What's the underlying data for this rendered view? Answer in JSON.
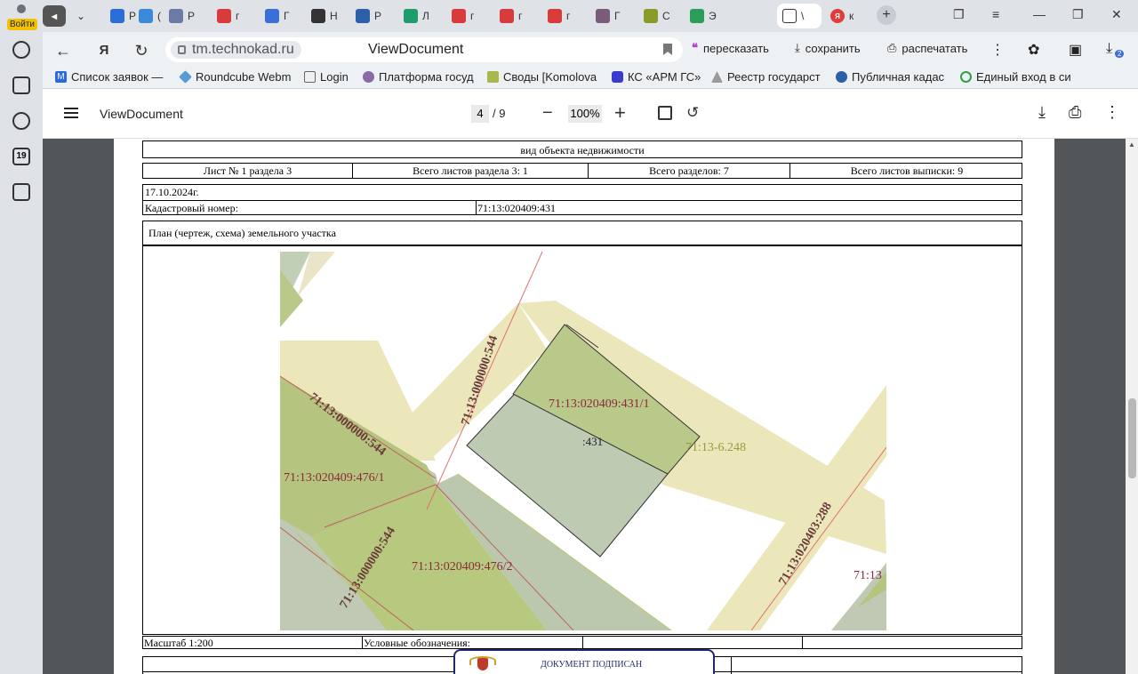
{
  "browser": {
    "profile_badge": "Войти",
    "tabs": [
      {
        "label": "Р",
        "color": "#2b6fd6"
      },
      {
        "label": "(",
        "color": "#3a8ad9"
      },
      {
        "label": "Р",
        "color": "#6b7ba3"
      },
      {
        "label": "г",
        "color": "#d83b3b"
      },
      {
        "label": "Г",
        "color": "#3b6fd6"
      },
      {
        "label": "Н",
        "color": "#333333"
      },
      {
        "label": "Р",
        "color": "#2b5fa8"
      },
      {
        "label": "Л",
        "color": "#1f9c6b"
      },
      {
        "label": "г",
        "color": "#d83b3b"
      },
      {
        "label": "г",
        "color": "#d83b3b"
      },
      {
        "label": "г",
        "color": "#d83b3b"
      },
      {
        "label": "Г",
        "color": "#7a5c7a"
      },
      {
        "label": "С",
        "color": "#8a9b2a"
      },
      {
        "label": "Э",
        "color": "#2c9c5c"
      },
      {
        "label": "\\",
        "color": "#555555"
      },
      {
        "label": "к",
        "color": "#e03c3c"
      }
    ],
    "address": {
      "host": "tm.technokad.ru",
      "title": "ViewDocument"
    },
    "actions": {
      "retell": "пересказать",
      "save": "сохранить",
      "print": "распечатать"
    },
    "downloads_count": "2",
    "bookmarks": [
      "Список заявок —",
      "Roundcube Webm",
      "Login",
      "Платформа госуд",
      "Своды [Komolova",
      "КС «АРМ ГС»",
      "Реестр государст",
      "Публичная кадас",
      "Единый вход в си"
    ],
    "rail_calendar": "19"
  },
  "viewer": {
    "title": "ViewDocument",
    "page_current": "4",
    "page_total": "9",
    "zoom": "100%"
  },
  "document": {
    "object_type_caption": "вид объекта недвижимости",
    "header_cells": [
      "Лист № 1 раздела 3",
      "Всего листов раздела 3: 1",
      "Всего разделов: 7",
      "Всего листов выписки: 9"
    ],
    "date": "17.10.2024г.",
    "cadastral_label": "Кадастровый номер:",
    "cadastral_number": "71:13:020409:431",
    "plan_caption": "План (чертеж, схема) земельного участка",
    "scale": "Масштаб 1:200",
    "legend_label": "Условные обозначения:",
    "signed_stamp": "ДОКУМЕНТ ПОДПИСАН",
    "map_labels": {
      "parcel_part": "71:13:020409:431/1",
      "parcel": ":431",
      "zone": "71:13-6.248",
      "road_top": "71:13:000000:544",
      "road_left": "71:13:000000:544",
      "road_bottom": "71:13:000000:544",
      "nb1": "71:13:020409:476/1",
      "nb2": "71:13:020409:476/2",
      "nb3": "71:13:020403:288",
      "nb4": "71:13"
    }
  }
}
